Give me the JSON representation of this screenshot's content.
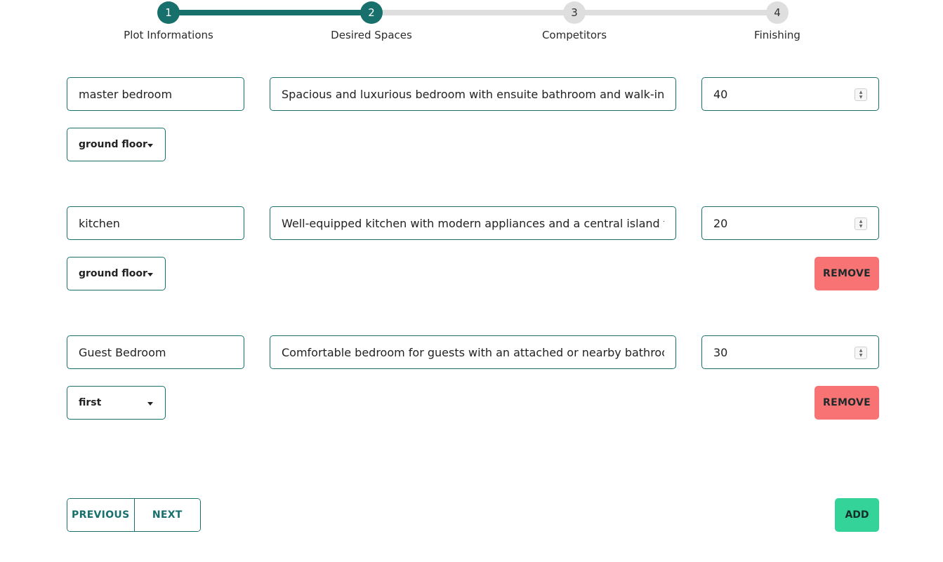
{
  "colors": {
    "primary": "#17706b",
    "inactive_step": "#dedede",
    "remove": "#f87373",
    "add": "#34d399"
  },
  "stepper": {
    "steps": [
      {
        "number": "1",
        "label": "Plot Informations",
        "state": "completed"
      },
      {
        "number": "2",
        "label": "Desired Spaces",
        "state": "active"
      },
      {
        "number": "3",
        "label": "Competitors",
        "state": "pending"
      },
      {
        "number": "4",
        "label": "Finishing",
        "state": "pending"
      }
    ]
  },
  "spaces": [
    {
      "name": "master bedroom",
      "description": "Spacious and luxurious bedroom with ensuite bathroom and walk-in closet.",
      "area": "40",
      "floor": "ground floor",
      "removable": false
    },
    {
      "name": "kitchen",
      "description": "Well-equipped kitchen with modern appliances and a central island for food",
      "area": "20",
      "floor": "ground floor",
      "removable": true
    },
    {
      "name": "Guest Bedroom",
      "description": "Comfortable bedroom for guests with an attached or nearby bathroom.",
      "area": "30",
      "floor": "first",
      "removable": true
    }
  ],
  "actions": {
    "remove_label": "REMOVE",
    "previous_label": "PREVIOUS",
    "next_label": "NEXT",
    "add_label": "ADD"
  }
}
